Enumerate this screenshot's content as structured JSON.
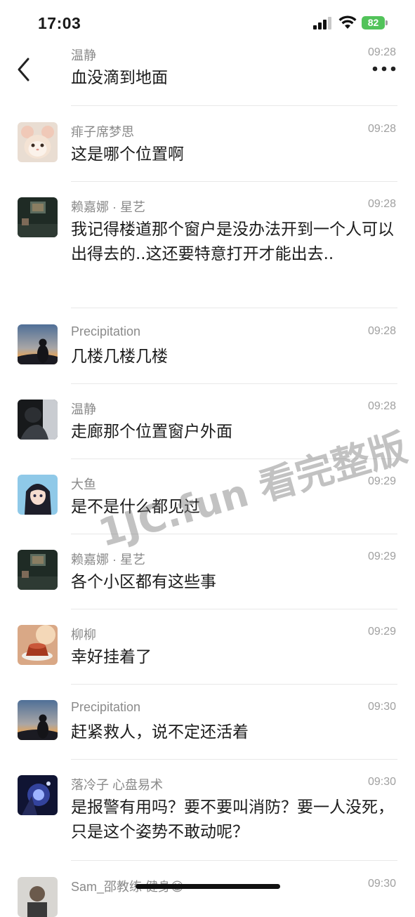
{
  "status_bar": {
    "time": "17:03",
    "battery": "82"
  },
  "colors": {
    "battery": "#52c35a",
    "name": "#8a8a8a",
    "divider": "#e8e8e8"
  },
  "messages": [
    {
      "name": "温静",
      "time": "09:28",
      "text": "血没滴到地面",
      "avatar": "none"
    },
    {
      "name": "痱子席梦思",
      "time": "09:28",
      "text": "这是哪个位置啊",
      "avatar": "cat-avatar"
    },
    {
      "name": "赖嘉娜 · 星艺",
      "time": "09:28",
      "text": "我记得楼道那个窗户是没办法开到一个人可以出得去的..这还要特意打开才能出去..",
      "avatar": "room-avatar"
    },
    {
      "name": "Precipitation",
      "time": "09:28",
      "text": "几楼几楼几楼",
      "avatar": "sunset-avatar"
    },
    {
      "name": "温静",
      "time": "09:28",
      "text": "走廊那个位置窗户外面",
      "avatar": "dark-photo-avatar"
    },
    {
      "name": "大鱼",
      "time": "09:29",
      "text": "是不是什么都见过",
      "avatar": "anime-avatar"
    },
    {
      "name": "赖嘉娜 · 星艺",
      "time": "09:29",
      "text": "各个小区都有这些事",
      "avatar": "room-avatar"
    },
    {
      "name": "柳柳",
      "time": "09:29",
      "text": "幸好挂着了",
      "avatar": "cake-avatar"
    },
    {
      "name": "Precipitation",
      "time": "09:30",
      "text": "赶紧救人，说不定还活着",
      "avatar": "sunset-avatar"
    },
    {
      "name": "落冷子  心盘易术",
      "time": "09:30",
      "text": "是报警有用吗？要不要叫消防？要一人没死，只是这个姿势不敢动呢？",
      "avatar": "fantasy-avatar"
    },
    {
      "name": "Sam_邵教练 健身😁",
      "time": "09:30",
      "text": "",
      "avatar": "person-avatar"
    }
  ],
  "watermark": "1JC.fun 看完整版"
}
